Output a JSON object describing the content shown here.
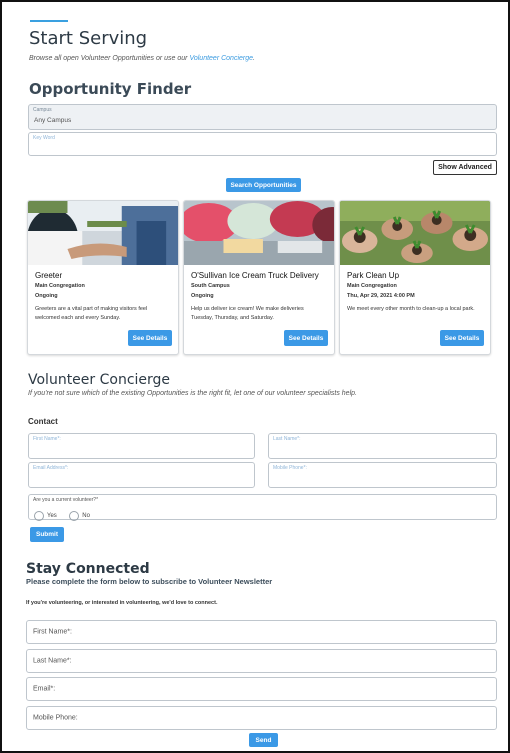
{
  "start": {
    "title": "Start Serving",
    "subtitle_prefix": "Browse all open Volunteer Opportunities or use our ",
    "subtitle_link": "Volunteer Concierge",
    "subtitle_suffix": "."
  },
  "finder": {
    "title": "Opportunity Finder",
    "campus_label": "Campus",
    "campus_value": "Any Campus",
    "keyword_label": "Key Word",
    "show_advanced": "Show Advanced",
    "search_button": "Search Opportunities"
  },
  "cards": [
    {
      "title": "Greeter",
      "campus": "Main Congregation",
      "schedule": "Ongoing",
      "description": "Greeters are a vital part of making visitors feel welcomed each and every Sunday.",
      "button": "See Details",
      "image": "greeter-handshake-image"
    },
    {
      "title": "O'Sullivan Ice Cream Truck Delivery",
      "campus": "South Campus",
      "schedule": "Ongoing",
      "description": "Help us deliver ice cream! We make deliveries Tuesday, Thursday, and Saturday.",
      "button": "See Details",
      "image": "ice-cream-image"
    },
    {
      "title": "Park Clean Up",
      "campus": "Main Congregation",
      "schedule": "Thu, Apr 29, 2021 4:00 PM",
      "description": "We meet every other month to clean-up a local park.",
      "button": "See Details",
      "image": "plants-in-hands-image"
    }
  ],
  "concierge": {
    "title": "Volunteer Concierge",
    "subtitle": "If you're not sure which of the existing Opportunities is the right fit, let one of our volunteer specialists help.",
    "contact_heading": "Contact",
    "first_name": "First Name*:",
    "last_name": "Last Name*:",
    "email": "Email Address*:",
    "mobile": "Mobile Phone*:",
    "current_volunteer": "Are you a current volunteer?*",
    "yes": "Yes",
    "no": "No",
    "submit": "Submit"
  },
  "connected": {
    "title": "Stay Connected",
    "subtitle": "Please complete the form below to subscribe to Volunteer Newsletter",
    "intro": "If you're volunteering, or interested in volunteering, we'd love to connect.",
    "first_name": "First Name*:",
    "last_name": "Last Name*:",
    "email": "Email*:",
    "mobile": "Mobile Phone:",
    "send": "Send"
  },
  "colors": {
    "accent": "#3b99e6",
    "heading": "#2d3a45"
  }
}
